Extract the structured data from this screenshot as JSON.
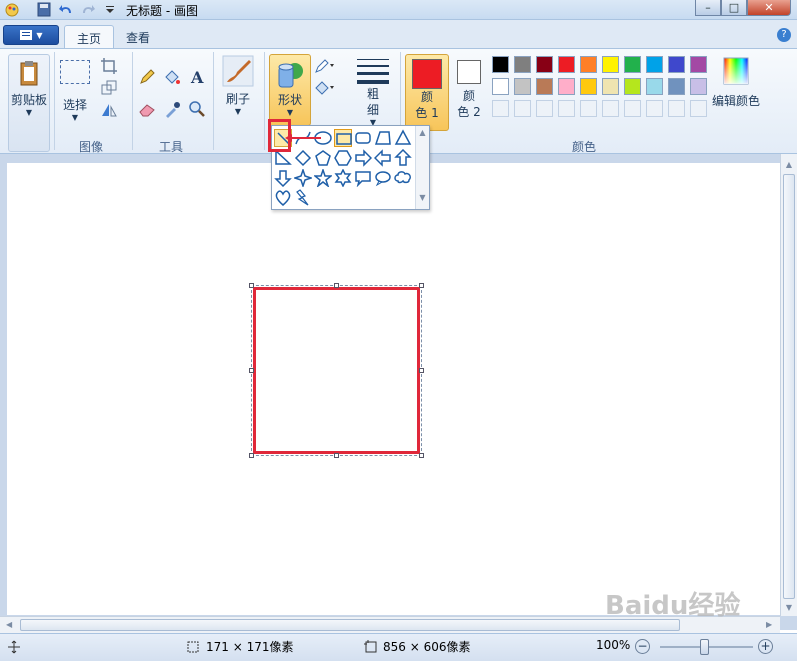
{
  "window": {
    "title": "无标题 - 画图"
  },
  "tabs": [
    {
      "label": "主页"
    },
    {
      "label": "查看"
    }
  ],
  "groups": {
    "clipboard": {
      "label": "剪贴板"
    },
    "image": {
      "label": "图像",
      "select_label": "选择"
    },
    "tools": {
      "label": "工具"
    },
    "brushes": {
      "label": "刷子"
    },
    "shapes": {
      "label": "形状"
    },
    "size": {
      "label": "粗\n细"
    },
    "color1": {
      "label": "颜\n色 1"
    },
    "color2": {
      "label": "颜\n色 2"
    },
    "colors": {
      "label": "颜色",
      "edit_label": "编辑颜色"
    }
  },
  "palette": {
    "row1": [
      "#000000",
      "#7f7f7f",
      "#880015",
      "#ed1c24",
      "#ff7f27",
      "#fff200",
      "#22b14c",
      "#00a2e8",
      "#3f48cc",
      "#a349a4"
    ],
    "row2": [
      "#ffffff",
      "#c3c3c3",
      "#b97a57",
      "#ffaec9",
      "#ffc90e",
      "#efe4b0",
      "#b5e61d",
      "#99d9ea",
      "#7092be",
      "#c8bfe7"
    ]
  },
  "colors_selected": {
    "color1": "#ed1c24",
    "color2": "#ffffff"
  },
  "shapes_panel": {
    "items": [
      "line",
      "curve",
      "oval",
      "rectangle",
      "rounded-rectangle",
      "polygon",
      "triangle",
      "right-triangle",
      "diamond",
      "pentagon",
      "hexagon",
      "right-arrow",
      "left-arrow",
      "up-arrow",
      "down-arrow",
      "four-point-star",
      "five-point-star",
      "six-point-star",
      "rounded-callout",
      "oval-callout",
      "cloud-callout",
      "heart",
      "lightning"
    ],
    "selected": "rectangle"
  },
  "status": {
    "selection_size": "171 × 171像素",
    "canvas_size": "856 × 606像素",
    "zoom": "100%"
  },
  "watermark": "Baidu经验"
}
